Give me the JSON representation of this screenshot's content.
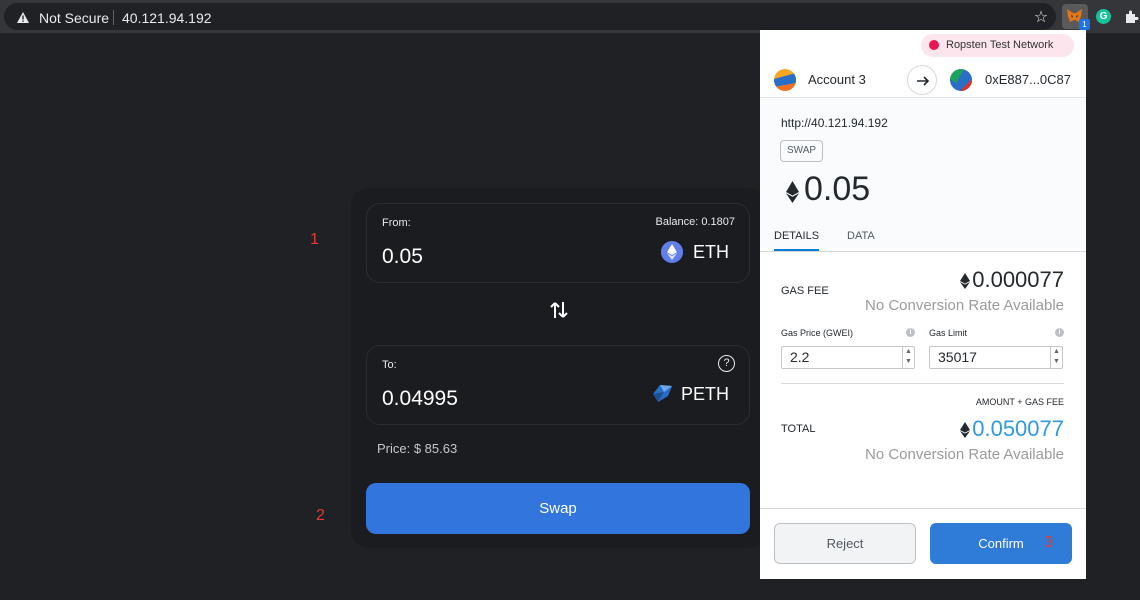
{
  "browser": {
    "security_label": "Not Secure",
    "url": "40.121.94.192",
    "metamask_badge": "1",
    "grammarly_letter": "G"
  },
  "dex": {
    "from_label": "From:",
    "balance": "Balance: 0.1807",
    "from_amount": "0.05",
    "from_token": "ETH",
    "to_label": "To:",
    "to_amount": "0.04995",
    "to_token": "PETH",
    "help": "?",
    "price": "Price: $ 85.63",
    "swap_label": "Swap"
  },
  "annotations": {
    "a1": "1",
    "a2": "2",
    "a3": "3"
  },
  "metamask": {
    "network": "Ropsten Test Network",
    "account_name": "Account 3",
    "to_address": "0xE887...0C87",
    "origin": "http://40.121.94.192",
    "method": "SWAP",
    "amount": "0.05",
    "tabs": {
      "details": "DETAILS",
      "data": "DATA"
    },
    "gas_fee_label": "GAS FEE",
    "gas_fee_value": "0.000077",
    "no_conversion": "No Conversion Rate Available",
    "gas_price_label": "Gas Price (GWEI)",
    "gas_price_value": "2.2",
    "gas_limit_label": "Gas Limit",
    "gas_limit_value": "35017",
    "amount_gas_label": "AMOUNT + GAS FEE",
    "total_label": "TOTAL",
    "total_value": "0.050077",
    "reject_label": "Reject",
    "confirm_label": "Confirm"
  },
  "colors": {
    "swap_button": "#3275dd",
    "confirm_button": "#2f7bd8",
    "total_value": "#2f9ae0",
    "network_dot": "#e91550",
    "annotation": "#e53935"
  }
}
